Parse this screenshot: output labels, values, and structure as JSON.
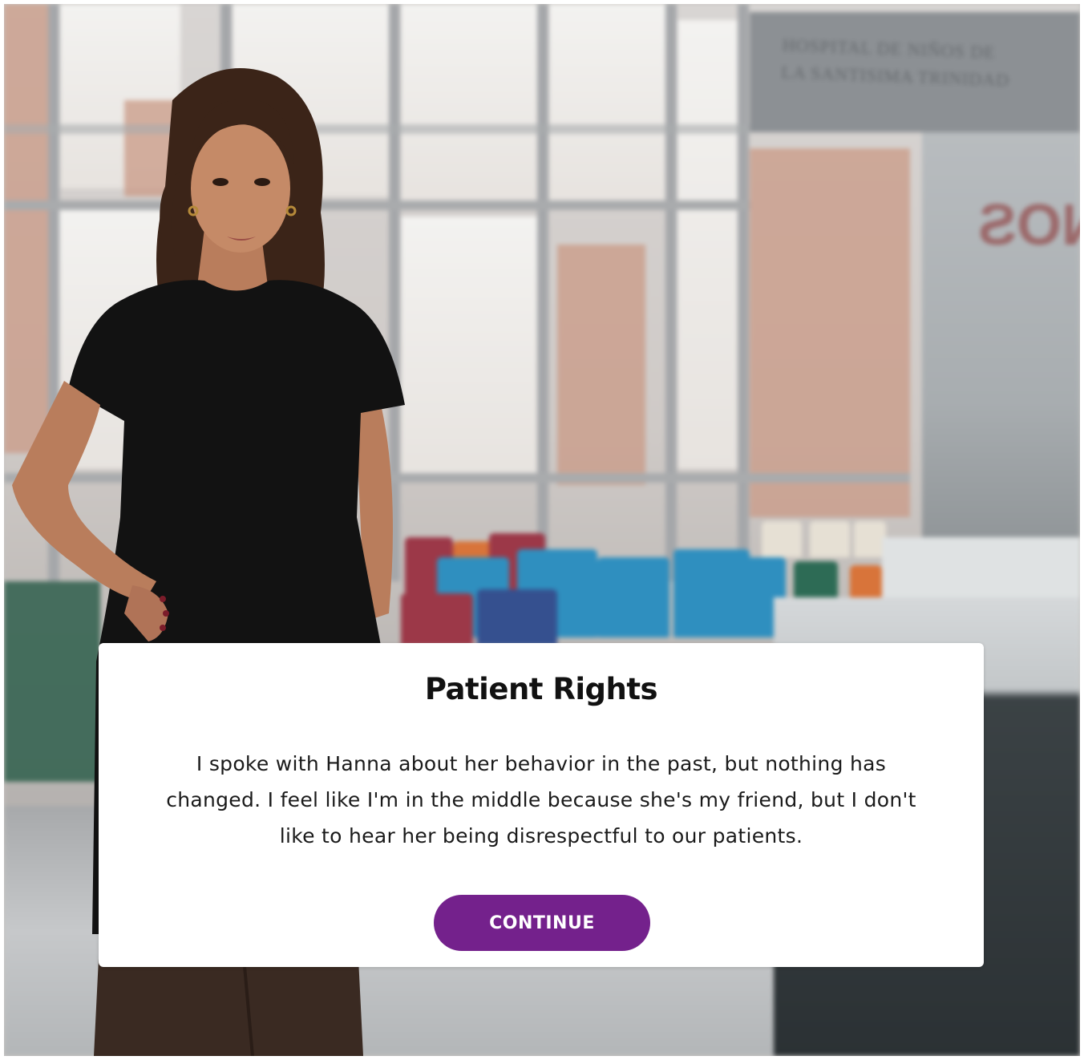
{
  "background": {
    "sign_line_1": "HOSPITAL DE NIÑOS DE",
    "sign_line_2": "LA SANTISIMA TRINIDAD",
    "mirrored_window_text": "NOS"
  },
  "dialog": {
    "title": "Patient Rights",
    "body": "I spoke with Hanna about her behavior in the past, but nothing has changed. I feel like I'm in the middle because she's my friend, but I don't like to hear her being disrespectful to our patients.",
    "continue_label": "CONTINUE"
  },
  "colors": {
    "accent": "#74218c",
    "card_background": "#ffffff",
    "title_text": "#111111"
  }
}
